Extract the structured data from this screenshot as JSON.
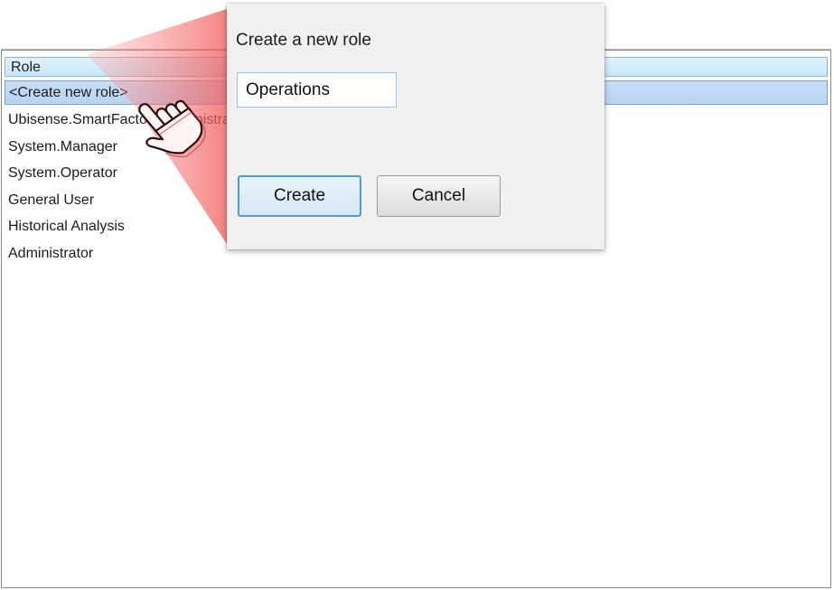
{
  "list": {
    "header": "Role",
    "rows": [
      "<Create new role>",
      "Ubisense.SmartFactory.Administrator",
      "System.Manager",
      "System.Operator",
      "General User",
      "Historical Analysis",
      "Administrator"
    ],
    "selected_index": 0
  },
  "dialog": {
    "title": "Create a new role",
    "input_value": "Operations",
    "create_label": "Create",
    "cancel_label": "Cancel"
  },
  "colors": {
    "header_bg": "#c7e8f8",
    "selection_bg": "#b8d3f2",
    "dialog_bg": "#f0f0f0",
    "callout_red": "#f05a5a",
    "primary_border": "#4d9bd4"
  },
  "icons": {
    "pointer": "hand-pointer-icon"
  }
}
